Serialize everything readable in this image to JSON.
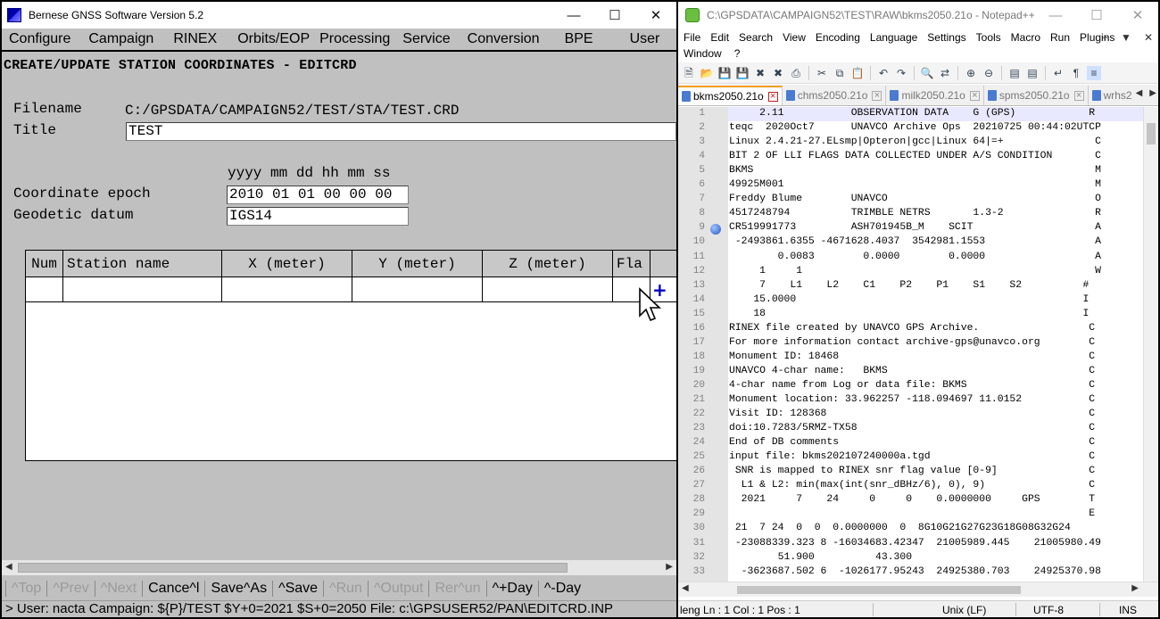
{
  "bernese": {
    "window_title": "Bernese GNSS Software Version 5.2",
    "menu": [
      "Configure",
      "Campaign",
      "RINEX",
      "Orbits/EOP",
      "Processing",
      "Service",
      "Conversion",
      "BPE",
      "User",
      "»"
    ],
    "panel_title": "CREATE/UPDATE STATION COORDINATES - EDITCRD",
    "filename_label": "Filename",
    "filename_value": "C:/GPSDATA/CAMPAIGN52/TEST/STA/TEST.CRD",
    "title_label": "Title",
    "title_value": "TEST",
    "epoch_format": "yyyy mm dd hh mm ss",
    "epoch_label": "Coordinate epoch",
    "epoch_value": "2010 01 01 00 00 00",
    "datum_label": "Geodetic datum",
    "datum_value": "IGS14",
    "table_columns": [
      "Num",
      "Station name",
      "X (meter)",
      "Y (meter)",
      "Z (meter)",
      "Fla"
    ],
    "buttons": [
      {
        "label": "^Top",
        "enabled": false
      },
      {
        "label": "^Prev",
        "enabled": false
      },
      {
        "label": "^Next",
        "enabled": false
      },
      {
        "label": "Cance^l",
        "enabled": true
      },
      {
        "label": "Save^As",
        "enabled": true
      },
      {
        "label": "^Save",
        "enabled": true
      },
      {
        "label": "^Run",
        "enabled": false
      },
      {
        "label": "^Output",
        "enabled": false
      },
      {
        "label": "Rer^un",
        "enabled": false
      },
      {
        "label": "^+Day",
        "enabled": true
      },
      {
        "label": "^-Day",
        "enabled": true
      }
    ],
    "status": "> User: nacta  Campaign: ${P}/TEST  $Y+0=2021  $S+0=2050  File: c:\\GPSUSER52/PAN\\EDITCRD.INP"
  },
  "npp": {
    "window_title": "C:\\GPSDATA\\CAMPAIGN52\\TEST\\RAW\\bkms2050.21o - Notepad++",
    "menu_row1": [
      "File",
      "Edit",
      "Search",
      "View",
      "Encoding",
      "Language",
      "Settings",
      "Tools",
      "Macro",
      "Run",
      "Plugins"
    ],
    "menu_row2": [
      "Window",
      "?"
    ],
    "menu_controls": [
      "+",
      "▼",
      "✕"
    ],
    "tabs": [
      {
        "label": "bkms2050.21o",
        "active": true
      },
      {
        "label": "chms2050.21o",
        "active": false
      },
      {
        "label": "milk2050.21o",
        "active": false
      },
      {
        "label": "spms2050.21o",
        "active": false
      },
      {
        "label": "wrhs2",
        "active": false
      }
    ],
    "lines": [
      {
        "n": "1",
        "t": "     2.11           OBSERVATION DATA    G (GPS)            R"
      },
      {
        "n": "2",
        "t": "teqc  2020Oct7      UNAVCO Archive Ops  20210725 00:44:02UTCP"
      },
      {
        "n": "3",
        "t": "Linux 2.4.21-27.ELsmp|Opteron|gcc|Linux 64|=+               C"
      },
      {
        "n": "4",
        "t": "BIT 2 OF LLI FLAGS DATA COLLECTED UNDER A/S CONDITION       C"
      },
      {
        "n": "5",
        "t": "BKMS                                                        M"
      },
      {
        "n": "6",
        "t": "49925M001                                                   M"
      },
      {
        "n": "7",
        "t": "Freddy Blume        UNAVCO                                  O"
      },
      {
        "n": "8",
        "t": "4517248794          TRIMBLE NETRS       1.3-2               R"
      },
      {
        "n": "9",
        "t": "CR519991773         ASH701945B_M    SCIT                    A"
      },
      {
        "n": "10",
        "t": " -2493861.6355 -4671628.4037  3542981.1553                  A"
      },
      {
        "n": "11",
        "t": "        0.0083        0.0000        0.0000                  A"
      },
      {
        "n": "12",
        "t": "     1     1                                                W"
      },
      {
        "n": "13",
        "t": "     7    L1    L2    C1    P2    P1    S1    S2          #"
      },
      {
        "n": "14",
        "t": "    15.0000                                               I"
      },
      {
        "n": "15",
        "t": "    18                                                    I"
      },
      {
        "n": "16",
        "t": "RINEX file created by UNAVCO GPS Archive.                  C"
      },
      {
        "n": "17",
        "t": "For more information contact archive-gps@unavco.org        C"
      },
      {
        "n": "18",
        "t": "Monument ID: 18468                                         C"
      },
      {
        "n": "19",
        "t": "UNAVCO 4-char name:   BKMS                                 C"
      },
      {
        "n": "20",
        "t": "4-char name from Log or data file: BKMS                    C"
      },
      {
        "n": "21",
        "t": "Monument location: 33.962257 -118.094697 11.0152           C"
      },
      {
        "n": "22",
        "t": "Visit ID: 128368                                           C"
      },
      {
        "n": "23",
        "t": "doi:10.7283/5RMZ-TX58                                      C"
      },
      {
        "n": "24",
        "t": "End of DB comments                                         C"
      },
      {
        "n": "25",
        "t": "input file: bkms202107240000a.tgd                          C"
      },
      {
        "n": "26",
        "t": " SNR is mapped to RINEX snr flag value [0-9]               C"
      },
      {
        "n": "27",
        "t": "  L1 & L2: min(max(int(snr_dBHz/6), 0), 9)                 C"
      },
      {
        "n": "28",
        "t": "  2021     7    24     0     0    0.0000000     GPS        T"
      },
      {
        "n": "29",
        "t": "                                                           E"
      },
      {
        "n": "30",
        "t": " 21  7 24  0  0  0.0000000  0  8G10G21G27G23G18G08G32G24"
      },
      {
        "n": "31",
        "t": " -23088339.323 8 -16034683.42347  21005989.445    21005980.49"
      },
      {
        "n": "32",
        "t": "        51.900          43.300"
      },
      {
        "n": "33",
        "t": "  -3623687.502 6  -1026177.95243  24925380.703    24925370.98"
      }
    ],
    "status": {
      "pos": "leng Ln : 1   Col : 1   Pos : 1",
      "eol": "Unix (LF)",
      "encoding": "UTF-8",
      "mode": "INS"
    }
  }
}
